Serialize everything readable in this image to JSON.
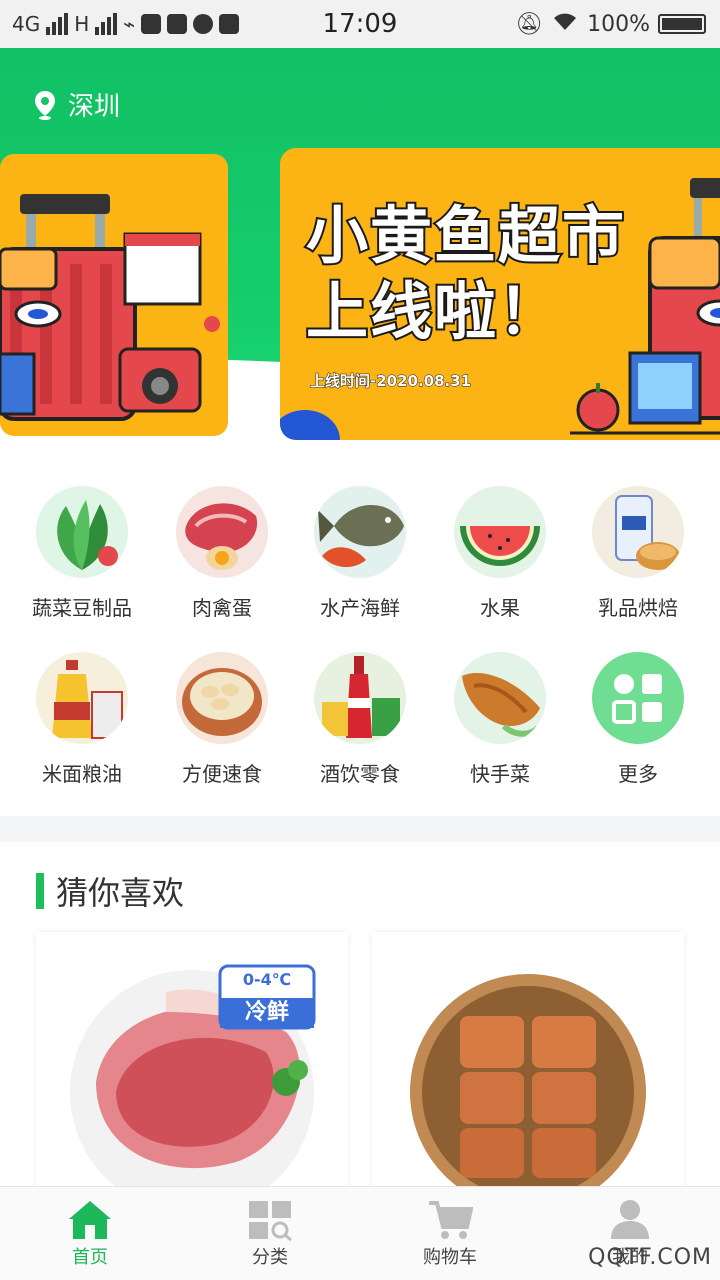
{
  "status_bar": {
    "network_4g": "4G",
    "network_h": "H",
    "time": "17:09",
    "battery": "100%"
  },
  "header": {
    "city": "深圳",
    "accent_color": "#14c466"
  },
  "banner": {
    "title_line1": "小黄鱼超市",
    "title_line2": "上线啦！",
    "date_text": "上线时间-2020.08.31",
    "background_color": "#fcb314"
  },
  "categories": [
    {
      "label": "蔬菜豆制品",
      "icon": "vegetables-icon"
    },
    {
      "label": "肉禽蛋",
      "icon": "meat-icon"
    },
    {
      "label": "水产海鲜",
      "icon": "seafood-icon"
    },
    {
      "label": "水果",
      "icon": "fruit-icon"
    },
    {
      "label": "乳品烘焙",
      "icon": "dairy-icon"
    },
    {
      "label": "米面粮油",
      "icon": "grain-oil-icon"
    },
    {
      "label": "方便速食",
      "icon": "instant-food-icon"
    },
    {
      "label": "酒饮零食",
      "icon": "drinks-snacks-icon"
    },
    {
      "label": "快手菜",
      "icon": "quick-dish-icon"
    },
    {
      "label": "更多",
      "icon": "more-grid-icon"
    }
  ],
  "recommend": {
    "title": "猜你喜欢",
    "products": [
      {
        "badge_temp": "0-4℃",
        "badge_text": "冷鲜",
        "image": "pork-meat"
      },
      {
        "image": "steamed-bread-basket"
      }
    ]
  },
  "tab_bar": {
    "active_color": "#1cb85a",
    "tabs": [
      {
        "label": "首页",
        "icon": "home-icon",
        "active": true
      },
      {
        "label": "分类",
        "icon": "category-icon",
        "active": false
      },
      {
        "label": "购物车",
        "icon": "cart-icon",
        "active": false
      },
      {
        "label": "我的",
        "icon": "user-icon",
        "active": false
      }
    ]
  },
  "watermark": "QQTF.COM"
}
